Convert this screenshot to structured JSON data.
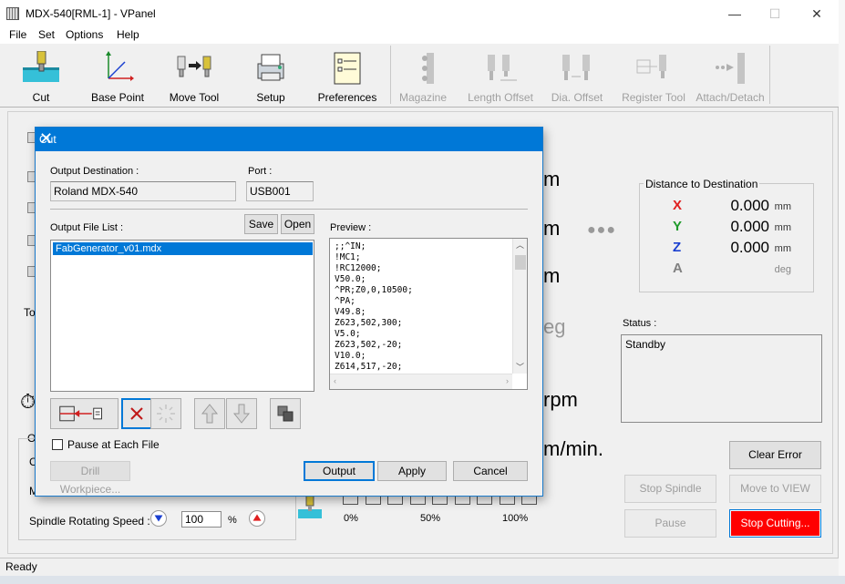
{
  "window": {
    "title": "MDX-540[RML-1] - VPanel",
    "minimize": "—",
    "maximize": "☐",
    "close": "✕"
  },
  "menu": [
    "File",
    "Set",
    "Options",
    "Help"
  ],
  "toolbar": [
    {
      "label": "Cut",
      "icon": "cut-icon",
      "enabled": true
    },
    {
      "label": "Base Point",
      "icon": "base-point-icon",
      "enabled": true
    },
    {
      "label": "Move Tool",
      "icon": "move-tool-icon",
      "enabled": true
    },
    {
      "label": "Setup",
      "icon": "setup-icon",
      "enabled": true
    },
    {
      "label": "Preferences",
      "icon": "preferences-icon",
      "enabled": true
    },
    {
      "label": "Magazine",
      "icon": "magazine-icon",
      "enabled": false
    },
    {
      "label": "Length Offset",
      "icon": "length-offset-icon",
      "enabled": false
    },
    {
      "label": "Dia. Offset",
      "icon": "dia-offset-icon",
      "enabled": false
    },
    {
      "label": "Register Tool",
      "icon": "register-tool-icon",
      "enabled": false
    },
    {
      "label": "Attach/Detach",
      "icon": "attach-detach-icon",
      "enabled": false
    }
  ],
  "panel": {
    "units": [
      "m",
      "m",
      "m",
      "eg",
      "rpm",
      "m/min."
    ],
    "dots": "●●●",
    "distance_title": "Distance to Destination",
    "distance": [
      {
        "axis": "X",
        "value": "0.000",
        "unit": "mm",
        "color": "#e02020"
      },
      {
        "axis": "Y",
        "value": "0.000",
        "unit": "mm",
        "color": "#1e9a2a"
      },
      {
        "axis": "Z",
        "value": "0.000",
        "unit": "mm",
        "color": "#1a3fd0"
      },
      {
        "axis": "A",
        "value": "",
        "unit": "deg",
        "color": "#808080"
      }
    ],
    "status_label": "Status :",
    "status_value": "Standby",
    "buttons": {
      "clear_error": "Clear Error",
      "stop_spindle": "Stop Spindle",
      "move_to_view": "Move to VIEW",
      "pause": "Pause",
      "stop_cutting": "Stop Cutting..."
    },
    "spindle_label": "Spindle Rotating Speed :",
    "spindle_value": "100",
    "spindle_unit": "%",
    "progress_ticks": [
      "0%",
      "50%",
      "100%"
    ],
    "progress_fraction": 0,
    "stray_labels": [
      "To",
      "O",
      "C",
      "M"
    ]
  },
  "status_bar": {
    "text": "Ready"
  },
  "dialog": {
    "title": "Cut",
    "close": "✕",
    "output_destination_label": "Output Destination :",
    "output_destination": "Roland MDX-540",
    "port_label": "Port :",
    "port": "USB001",
    "output_file_list_label": "Output File List :",
    "save": "Save",
    "open": "Open",
    "files": [
      "FabGenerator_v01.mdx"
    ],
    "preview_label": "Preview :",
    "preview_lines": [
      ";;^IN;",
      "!MC1;",
      "!RC12000;",
      "V50.0;",
      "^PR;Z0,0,10500;",
      "^PA;",
      "V49.8;",
      "Z623,502,300;",
      "V5.0;",
      "Z623,502,-20;",
      "V10.0;",
      "Z614,517,-20;"
    ],
    "pause_each_file": "Pause at Each File",
    "drill_workpiece": "Drill Workpiece...",
    "output": "Output",
    "apply": "Apply",
    "cancel": "Cancel"
  },
  "accent": {
    "titlebar": "#0078d7",
    "stop": "#ff0000"
  }
}
